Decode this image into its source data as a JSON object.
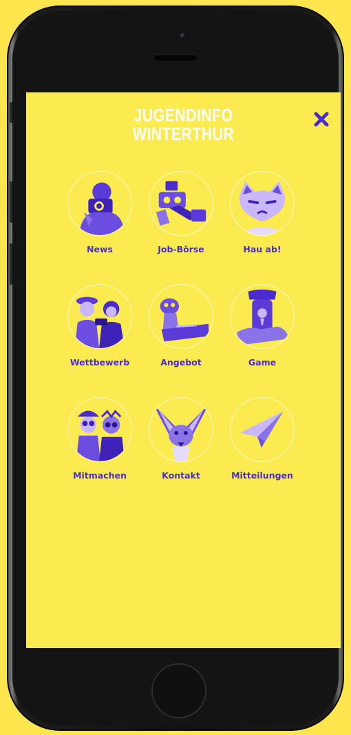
{
  "app": {
    "title_line1": "JUGENDINFO",
    "title_line2": "WINTERTHUR"
  },
  "colors": {
    "background": "#fbeb50",
    "accent": "#4a2bd0",
    "title": "#ffffff"
  },
  "menu": {
    "items": [
      {
        "label": "News",
        "icon": "photographer-icon"
      },
      {
        "label": "Job-Börse",
        "icon": "robot-icon"
      },
      {
        "label": "Hau ab!",
        "icon": "grumpy-cat-icon"
      },
      {
        "label": "Wettbewerb",
        "icon": "people-icon"
      },
      {
        "label": "Angebot",
        "icon": "ferret-icon"
      },
      {
        "label": "Game",
        "icon": "phone-hand-icon"
      },
      {
        "label": "Mitmachen",
        "icon": "costume-people-icon"
      },
      {
        "label": "Kontakt",
        "icon": "fennec-fox-icon"
      },
      {
        "label": "Mitteilungen",
        "icon": "paper-plane-icon"
      }
    ]
  }
}
